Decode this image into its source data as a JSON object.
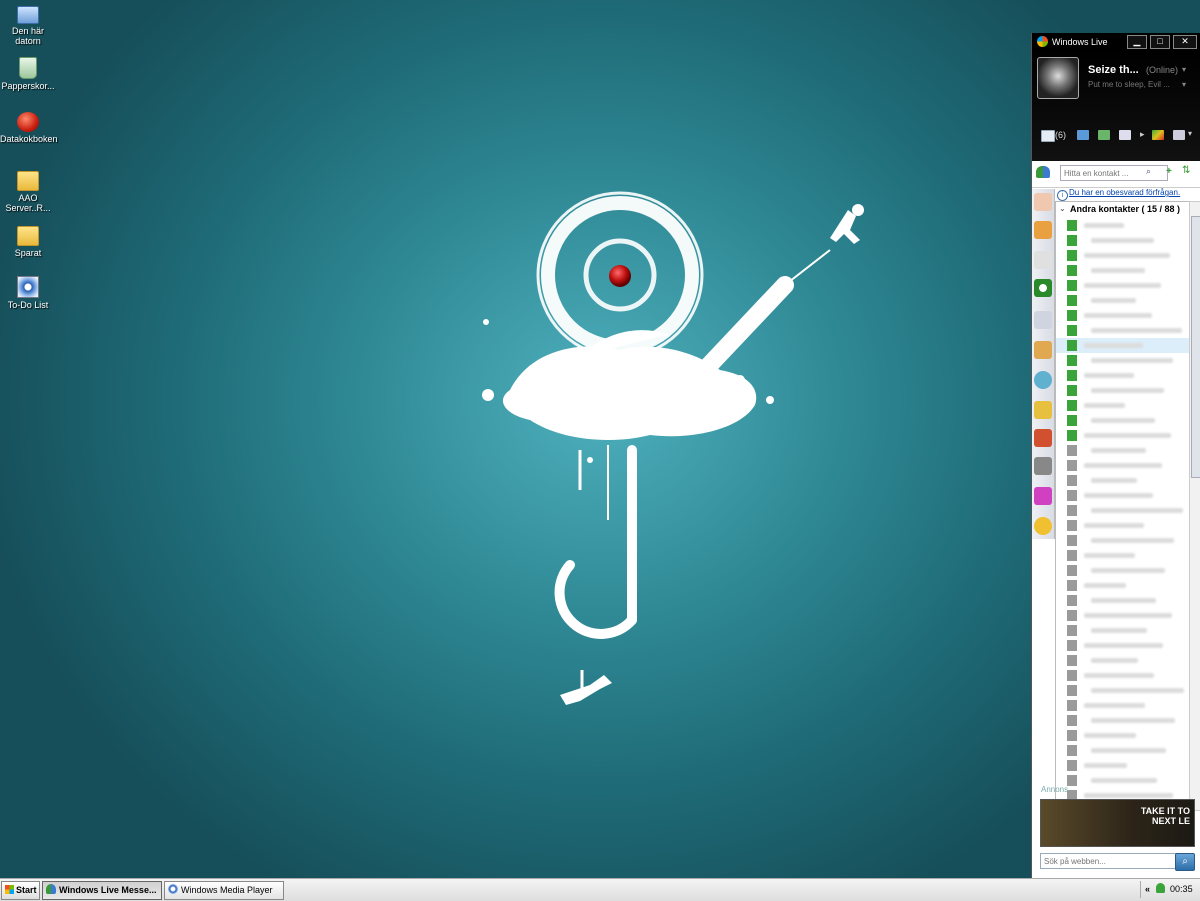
{
  "desktop": {
    "icons": [
      {
        "label": "Den här datorn",
        "icon": "computer-icon"
      },
      {
        "label": "Papperskor...",
        "icon": "recycle-bin-icon"
      },
      {
        "label": "Datakokboken",
        "icon": "tomato-app-icon"
      },
      {
        "label": "AAO Server..R...",
        "icon": "folder-icon"
      },
      {
        "label": "Sparat",
        "icon": "folder-icon"
      },
      {
        "label": "To-Do List",
        "icon": "media-shortcut-icon"
      }
    ]
  },
  "messenger": {
    "title": "Windows Live",
    "window_buttons": {
      "minimize": "▁",
      "maximize": "□",
      "close": "✕"
    },
    "user": {
      "name": "Seize th...",
      "status": "(Online)",
      "personal_message": "Put me to sleep, Evil ..."
    },
    "mail_count": "(6)",
    "search_placeholder": "Hitta en kontakt ...",
    "notice": "Du har en obesvarad förfrågan.",
    "group_header": "Andra kontakter ( 15 / 88 )",
    "ad_label": "Annons",
    "banner": {
      "line1": "TAKE IT TO",
      "line2": "NEXT LE"
    },
    "web_search_placeholder": "Sök på webben...",
    "accent": "#3a8fd0",
    "online_color": "#3aa33a",
    "offline_color": "#9a9a9a"
  },
  "taskbar": {
    "start_label": "Start",
    "buttons": [
      {
        "label": "Windows Live Messe...",
        "active": true
      },
      {
        "label": "Windows Media Player",
        "active": false
      }
    ],
    "clock": "00:35"
  }
}
